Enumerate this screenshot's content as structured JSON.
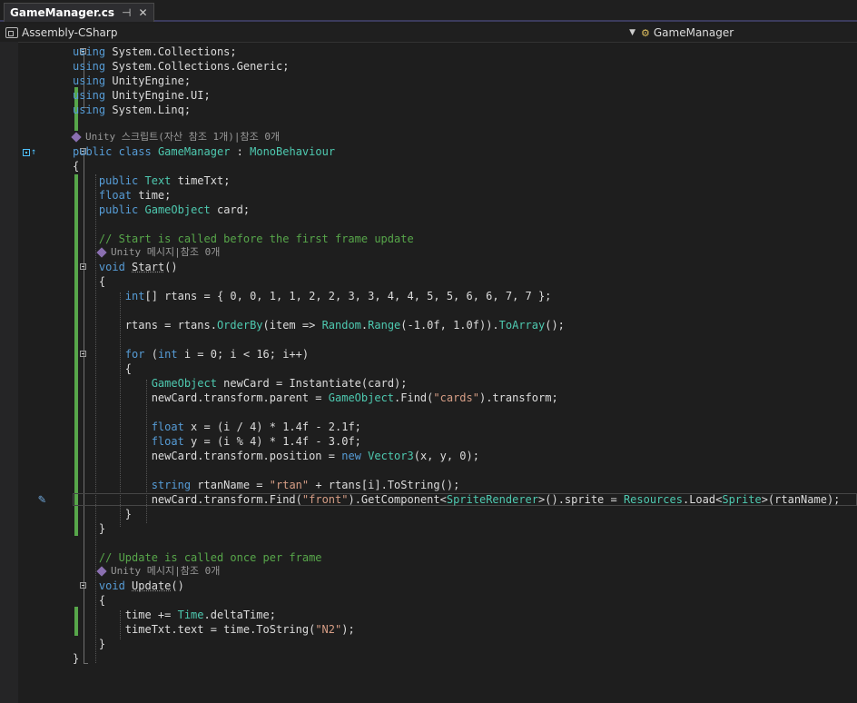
{
  "tab": {
    "title": "GameManager.cs",
    "pin_icon": "pin-icon",
    "close_icon": "close-icon"
  },
  "nav": {
    "project": "Assembly-CSharp",
    "class": "GameManager"
  },
  "lens": {
    "class_refs": "Unity 스크립트(자산 참조 1개)|참조 0개",
    "start_refs": "Unity 메시지|참조 0개",
    "update_refs": "Unity 메시지|참조 0개"
  },
  "code": {
    "l1": [
      "using",
      " System.Collections;"
    ],
    "l2": [
      "using",
      " System.Collections.Generic;"
    ],
    "l3": [
      "using",
      " UnityEngine;"
    ],
    "l4": [
      "using",
      " UnityEngine.UI;"
    ],
    "l5": [
      "using",
      " System.Linq;"
    ],
    "l6": [
      "public",
      " ",
      "class",
      " ",
      "GameManager",
      " : ",
      "MonoBehaviour"
    ],
    "l7": "{",
    "l8": [
      "    ",
      "public",
      " ",
      "Text",
      " timeTxt;"
    ],
    "l9": [
      "    ",
      "float",
      " time;"
    ],
    "l10": [
      "    ",
      "public",
      " ",
      "GameObject",
      " card;"
    ],
    "l11": "    // Start is called before the first frame update",
    "l12": [
      "    ",
      "void",
      " ",
      "Start",
      "()"
    ],
    "l13": "    {",
    "l14": [
      "        ",
      "int",
      "[] rtans = { 0, 0, 1, 1, 2, 2, 3, 3, 4, 4, 5, 5, 6, 6, 7, 7 };"
    ],
    "l15": [
      "        rtans = rtans.",
      "OrderBy",
      "(item => ",
      "Random",
      ".",
      "Range",
      "(-1.0f, 1.0f)).",
      "ToArray",
      "();"
    ],
    "l16": [
      "        ",
      "for",
      " (",
      "int",
      " i = 0; i < 16; i++)"
    ],
    "l17": "        {",
    "l18": [
      "            ",
      "GameObject",
      " newCard = ",
      "Instantiate",
      "(card);"
    ],
    "l19": [
      "            newCard.transform.parent = ",
      "GameObject",
      ".",
      "Find",
      "(",
      "\"cards\"",
      ").transform;"
    ],
    "l20": [
      "            ",
      "float",
      " x = (i / 4) * 1.4f - 2.1f;"
    ],
    "l21": [
      "            ",
      "float",
      " y = (i % 4) * 1.4f - 3.0f;"
    ],
    "l22": [
      "            newCard.transform.position = ",
      "new",
      " ",
      "Vector3",
      "(x, y, 0);"
    ],
    "l23": [
      "            ",
      "string",
      " rtanName = ",
      "\"rtan\"",
      " + rtans[i].",
      "ToString",
      "();"
    ],
    "l24": [
      "            newCard.transform.",
      "Find",
      "(",
      "\"front\"",
      ").",
      "GetComponent",
      "<",
      "SpriteRenderer",
      ">().sprite = ",
      "Resources",
      ".",
      "Load",
      "<",
      "Sprite",
      ">(rtanName);"
    ],
    "l25": "        }",
    "l26": "    }",
    "l27": "    // Update is called once per frame",
    "l28": [
      "    ",
      "void",
      " ",
      "Update",
      "()"
    ],
    "l29": "    {",
    "l30": [
      "        time += ",
      "Time",
      ".deltaTime;"
    ],
    "l31": [
      "        timeTxt.text = time.",
      "ToString",
      "(",
      "\"N2\"",
      ");"
    ],
    "l32": "    }",
    "l33": "}"
  },
  "colors": {
    "keyword": "#569cd6",
    "type": "#4ec9b0",
    "string": "#d69d85",
    "comment": "#57a64a",
    "background": "#1e1e1e",
    "change_bar": "#57a64a"
  }
}
